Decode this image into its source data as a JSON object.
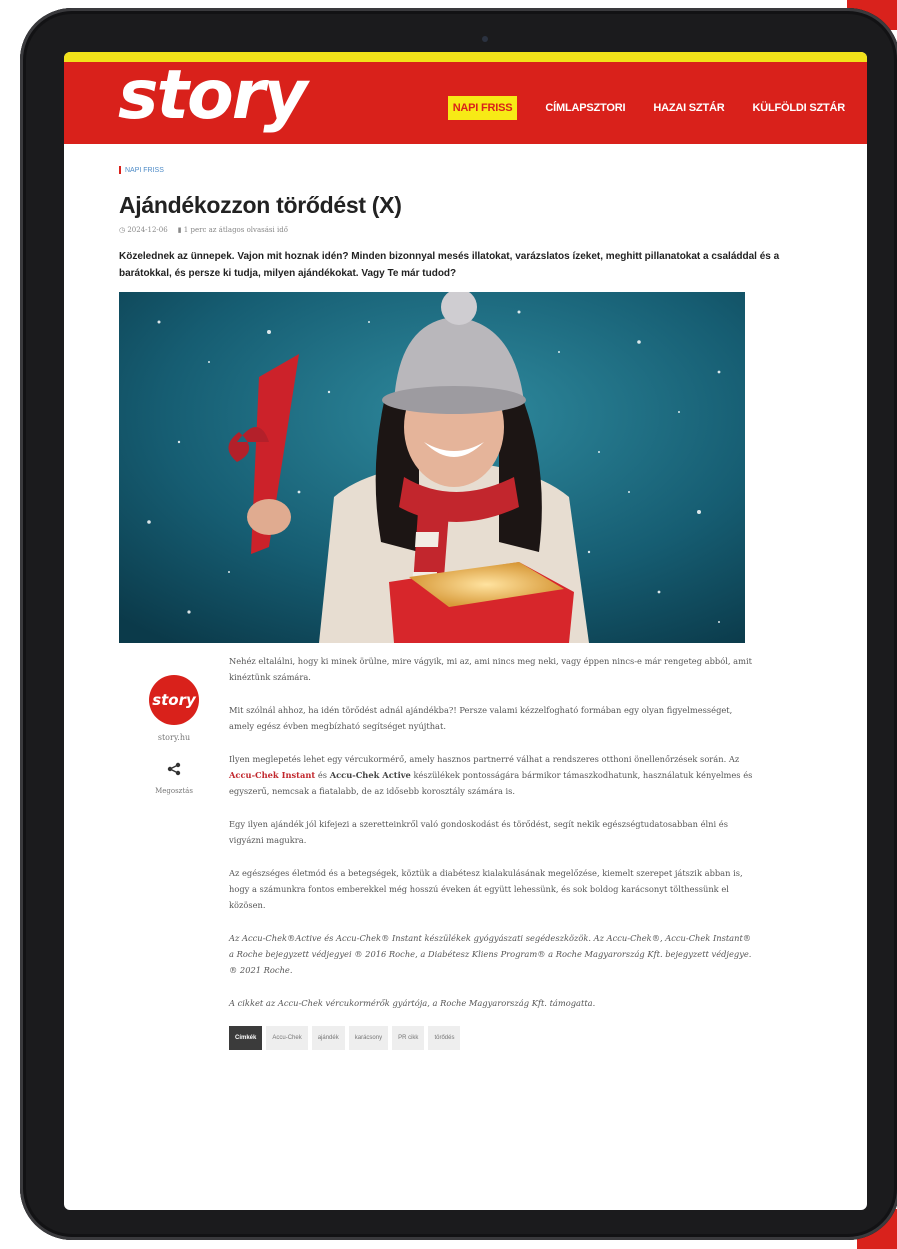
{
  "site": {
    "logo": "story",
    "nav": [
      {
        "label": "NAPI FRISS",
        "active": true
      },
      {
        "label": "CÍMLAPSZTORI",
        "active": false
      },
      {
        "label": "HAZAI SZTÁR",
        "active": false
      },
      {
        "label": "KÜLFÖLDI SZTÁR",
        "active": false
      }
    ]
  },
  "article": {
    "breadcrumb": "NAPI FRISS",
    "title": "Ajándékozzon törődést (X)",
    "date": "2024-12-06",
    "read_time": "1 perc az átlagos olvasási idő",
    "lead": "Közelednek az ünnepek. Vajon mit hoznak idén? Minden bizonnyal mesés illatokat, varázslatos ízeket, meghitt pillanatokat a családdal és a barátokkal, és persze ki tudja, milyen ajándékokat. Vagy Te már tudod?",
    "p1": "Nehéz eltalálni, hogy ki minek örülne, mire vágyik, mi az, ami nincs meg neki, vagy éppen nincs-e már rengeteg abból, amit kinéztünk számára.",
    "p2": "Mit szólnál ahhoz, ha idén törődést adnál ajándékba?! Persze valami kézzelfogható formában egy olyan figyelmességet, amely egész évben megbízható segítséget nyújthat.",
    "p3_a": "Ilyen meglepetés lehet egy vércukormérő, amely hasznos partnerré válhat a rendszeres otthoni önellenőrzések során. Az ",
    "p3_link1": "Accu-Chek Instant",
    "p3_b": " és ",
    "p3_bold": "Accu-Chek Active",
    "p3_c": " készülékek pontosságára bármikor támaszkodhatunk, használatuk kényelmes és egyszerű, nemcsak a fiatalabb, de az idősebb korosztály számára is.",
    "p4": "Egy ilyen ajándék jól kifejezi a szeretteinkről való gondoskodást és törődést, segít nekik egészségtudatosabban élni és vigyázni magukra.",
    "p5": "Az egészséges életmód és a betegségek, köztük a diabétesz kialakulásának megelőzése, kiemelt szerepet játszik abban is, hogy a számunkra fontos emberekkel még hosszú éveken át együtt lehessünk, és sok boldog karácsonyt tölthessünk el közösen.",
    "p6": "Az Accu-Chek®Active és Accu-Chek® Instant készülékek gyógyászati segédeszközök. Az Accu-Chek®, Accu-Chek Instant® a Roche bejegyzett védjegyei ® 2016 Roche, a Diabétesz Kliens Program® a Roche Magyarország Kft. bejegyzett védjegye. ® 2021 Roche.",
    "p7": "A cikket az Accu-Chek vércukormérők gyártója, a Roche Magyarország Kft. támogatta."
  },
  "sidebar": {
    "avatar_text": "story",
    "site_label": "story.hu",
    "share_label": "Megosztás"
  },
  "tags": {
    "heading": "Címkék",
    "items": [
      "Accu-Chek",
      "ajándék",
      "karácsony",
      "PR cikk",
      "törődés"
    ]
  },
  "colors": {
    "brand_red": "#d9211b",
    "brand_yellow": "#f7ea16",
    "link_red": "#c1272d"
  }
}
